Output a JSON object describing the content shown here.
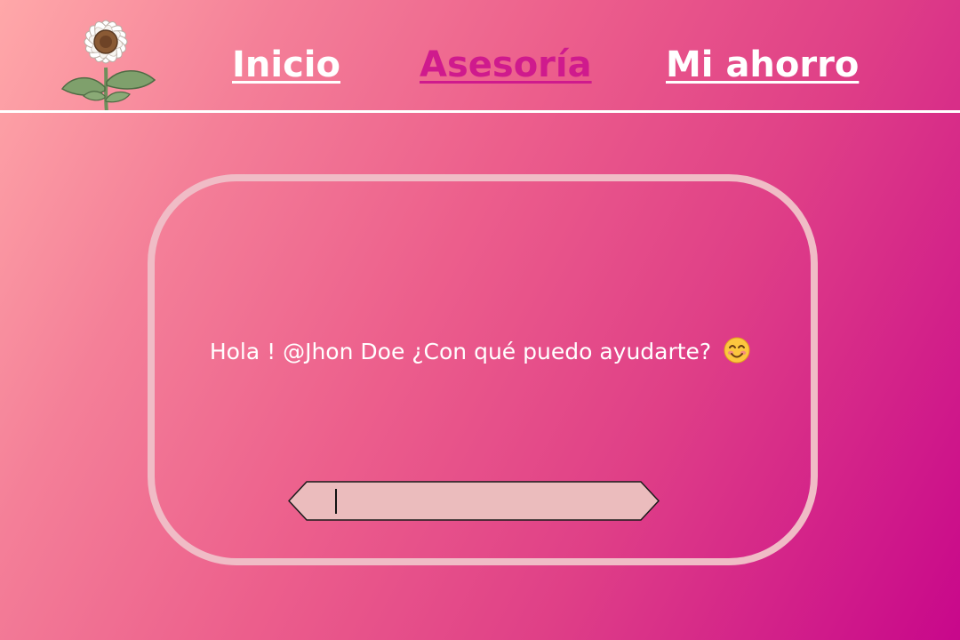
{
  "header": {
    "logo_icon": "sunflower-icon",
    "nav": [
      {
        "id": "inicio",
        "label": "Inicio",
        "active": false
      },
      {
        "id": "asesoria",
        "label": "Asesoría",
        "active": true
      },
      {
        "id": "ahorro",
        "label": "Mi ahorro",
        "active": false
      }
    ]
  },
  "chat": {
    "greeting": "Hola ! @Jhon Doe ¿Con qué puedo ayudarte?",
    "greeting_icon": "smiling-face-icon",
    "input_value": ""
  },
  "colors": {
    "gradient_start": "#ffa8a9",
    "gradient_end": "#c8078b",
    "active_nav": "#cf1a8d",
    "panel_border": "#f0bcc6",
    "input_fill": "#ebbcbd"
  }
}
